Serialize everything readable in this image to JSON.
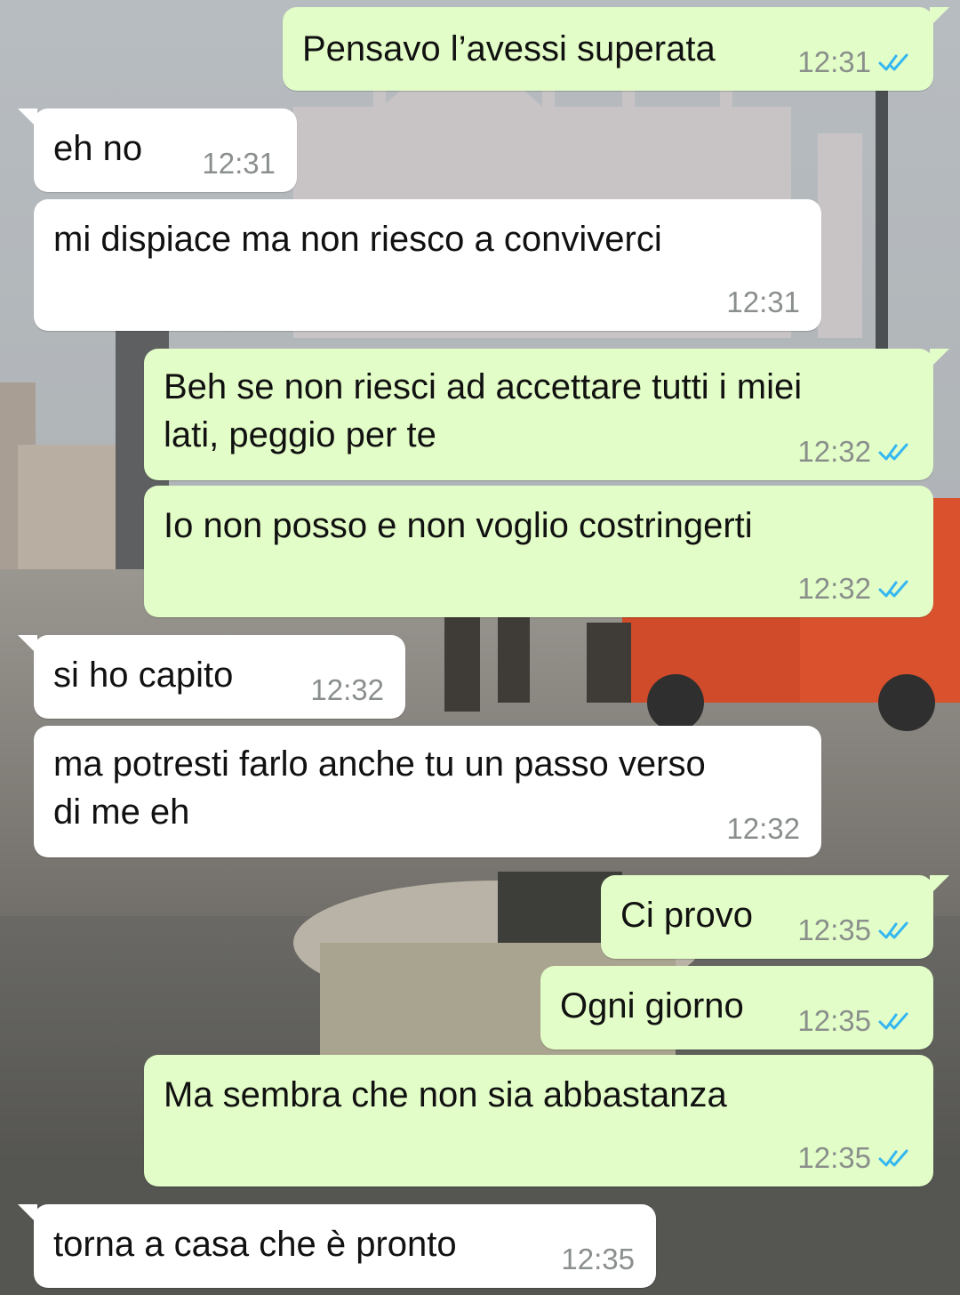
{
  "chat": {
    "messages": [
      {
        "direction": "out",
        "text": "Pensavo l’avessi superata",
        "time": "12:31",
        "status": "read"
      },
      {
        "direction": "in",
        "text": "eh no",
        "time": "12:31"
      },
      {
        "direction": "in",
        "text": "mi dispiace ma non riesco a conviverci",
        "time": "12:31"
      },
      {
        "direction": "out",
        "text_line1": "Beh se non riesci ad accettare tutti i miei",
        "text_line2": "lati, peggio per te",
        "time": "12:32",
        "status": "read"
      },
      {
        "direction": "out",
        "text": "Io non posso e non voglio costringerti",
        "time": "12:32",
        "status": "read"
      },
      {
        "direction": "in",
        "text": "si ho capito",
        "time": "12:32"
      },
      {
        "direction": "in",
        "text_line1": "ma potresti farlo anche tu un passo verso",
        "text_line2": "di me eh",
        "time": "12:32"
      },
      {
        "direction": "out",
        "text": "Ci provo",
        "time": "12:35",
        "status": "read"
      },
      {
        "direction": "out",
        "text": "Ogni giorno",
        "time": "12:35",
        "status": "read"
      },
      {
        "direction": "out",
        "text": "Ma sembra che non sia abbastanza",
        "time": "12:35",
        "status": "read"
      },
      {
        "direction": "in",
        "text": "torna a casa che è pronto",
        "time": "12:35"
      }
    ]
  },
  "colors": {
    "incoming_bubble": "#ffffff",
    "outgoing_bubble": "#e2fdc7",
    "timestamp": "#8a8f8c",
    "read_ticks": "#34b7f1"
  },
  "icons": {
    "read_status": "double-check-icon"
  }
}
